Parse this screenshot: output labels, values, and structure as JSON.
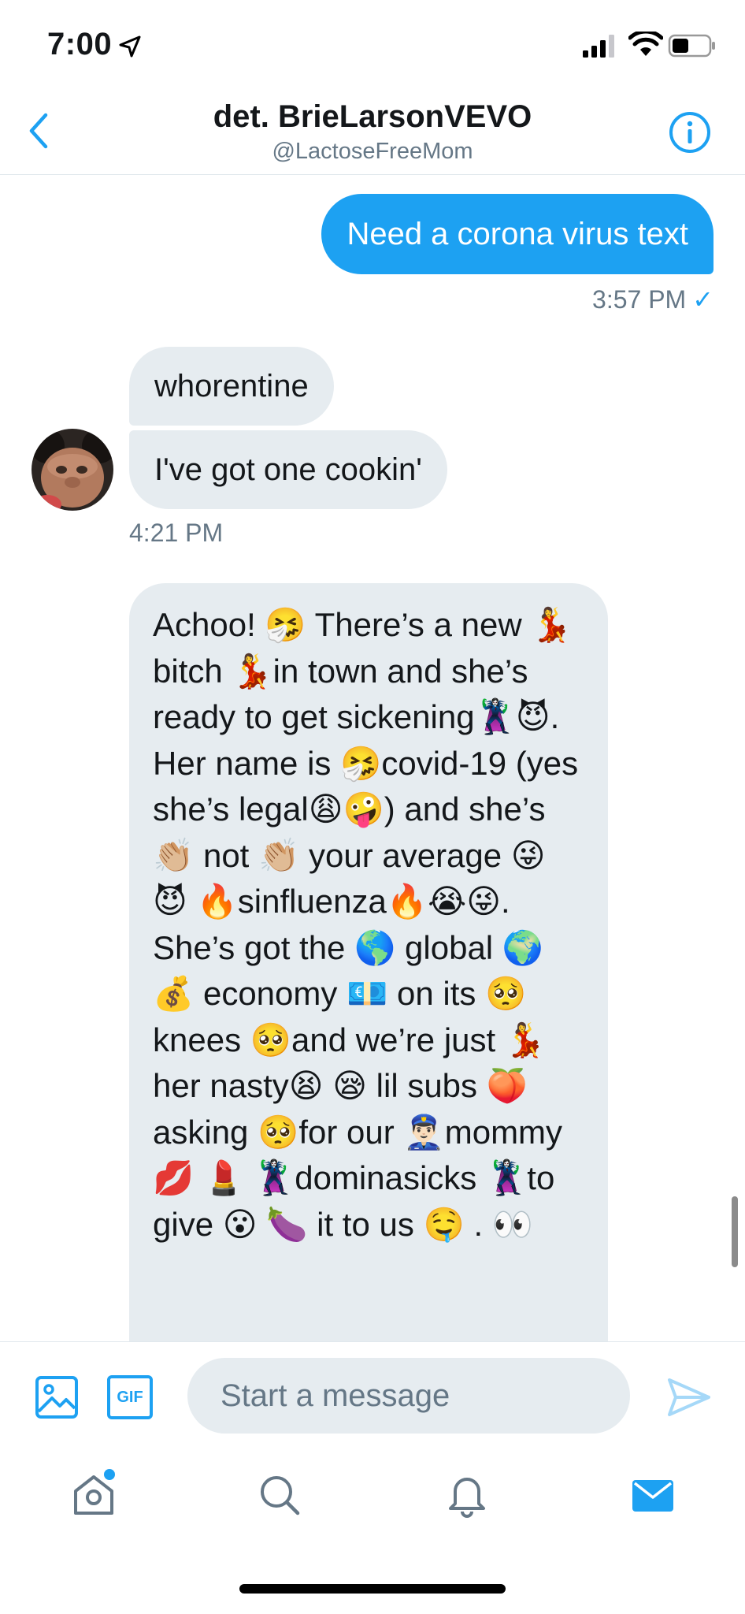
{
  "status_bar": {
    "time": "7:00"
  },
  "header": {
    "title": "det. BrieLarsonVEVO",
    "handle": "@LactoseFreeMom"
  },
  "messages": {
    "outgoing_text": "Need a corona virus text",
    "outgoing_time": "3:57 PM",
    "outgoing_status": "✓",
    "incoming_1": "whorentine",
    "incoming_2": "I've got one cookin'",
    "incoming_time": "4:21 PM",
    "long_message": "Achoo! 🤧 There’s a new 💃bitch 💃in town and she’s ready to get sickening🦹‍♀️😈. Her name is 🤧covid-19 (yes she’s legal😩🤪) and she’s 👏🏼 not 👏🏼 your average 😜 😈 🔥sinfluenza🔥😭😜. She’s got the 🌎 global 🌍 💰 economy 💶 on its 🥺 knees 🥺and we’re just 💃 her nasty😫 😪 lil subs 🍑asking 🥺for our 👮🏻‍♂️mommy 💋 💄 🦹‍♀️dominasicks 🦹‍♀️to give 😮 🍆 it to us 🤤 . 👀"
  },
  "compose": {
    "placeholder": "Start a message",
    "gif_label": "GIF"
  },
  "icons": {
    "back": "chevron-left-icon",
    "info": "info-icon",
    "image": "image-icon",
    "gif": "gif-icon",
    "send": "send-icon",
    "nav": [
      "home-icon",
      "search-icon",
      "bell-icon",
      "mail-icon"
    ]
  },
  "colors": {
    "accent": "#1da1f2",
    "incoming_bubble": "#e6ecf0",
    "secondary_text": "#657786"
  }
}
